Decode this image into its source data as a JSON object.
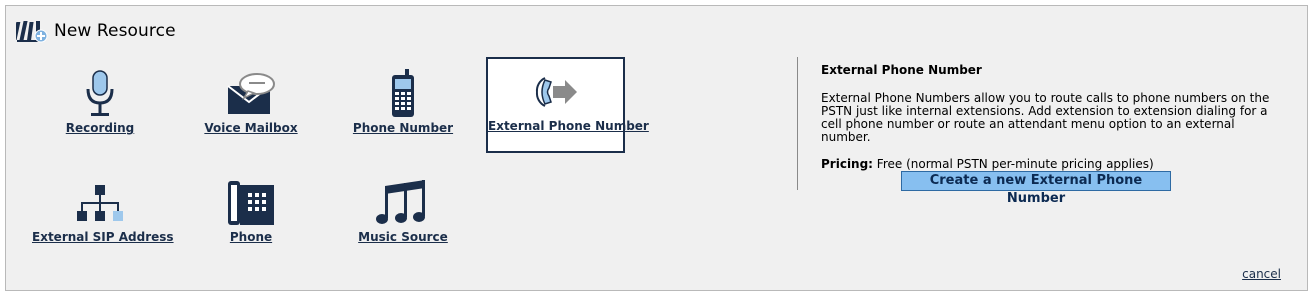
{
  "dialog": {
    "title": "New Resource",
    "logo_icon": "resource-books-icon"
  },
  "tiles": [
    {
      "label": "Recording",
      "icon": "microphone-icon",
      "selected": false
    },
    {
      "label": "Voice Mailbox",
      "icon": "envelope-speech-icon",
      "selected": false
    },
    {
      "label": "Phone Number",
      "icon": "mobile-phone-icon",
      "selected": false
    },
    {
      "label": "External Phone Number",
      "icon": "handset-arrow-icon",
      "selected": true
    },
    {
      "label": "External SIP Address",
      "icon": "network-tree-icon",
      "selected": false
    },
    {
      "label": "Phone",
      "icon": "desk-phone-icon",
      "selected": false
    },
    {
      "label": "Music Source",
      "icon": "music-notes-icon",
      "selected": false
    }
  ],
  "info": {
    "title": "External Phone Number",
    "description": "External Phone Numbers allow you to route calls to phone numbers on the PSTN just like internal extensions. Add extension to extension dialing for a cell phone number or route an attendant menu option to an external number.",
    "pricing_label": "Pricing:",
    "pricing_value": " Free (normal PSTN per-minute pricing applies)",
    "create_button": "Create a new External Phone Number"
  },
  "footer": {
    "cancel_label": "cancel"
  },
  "colors": {
    "navy": "#1b2e4a",
    "button_bg": "#87bff0",
    "panel_bg": "#f0f0f0"
  }
}
